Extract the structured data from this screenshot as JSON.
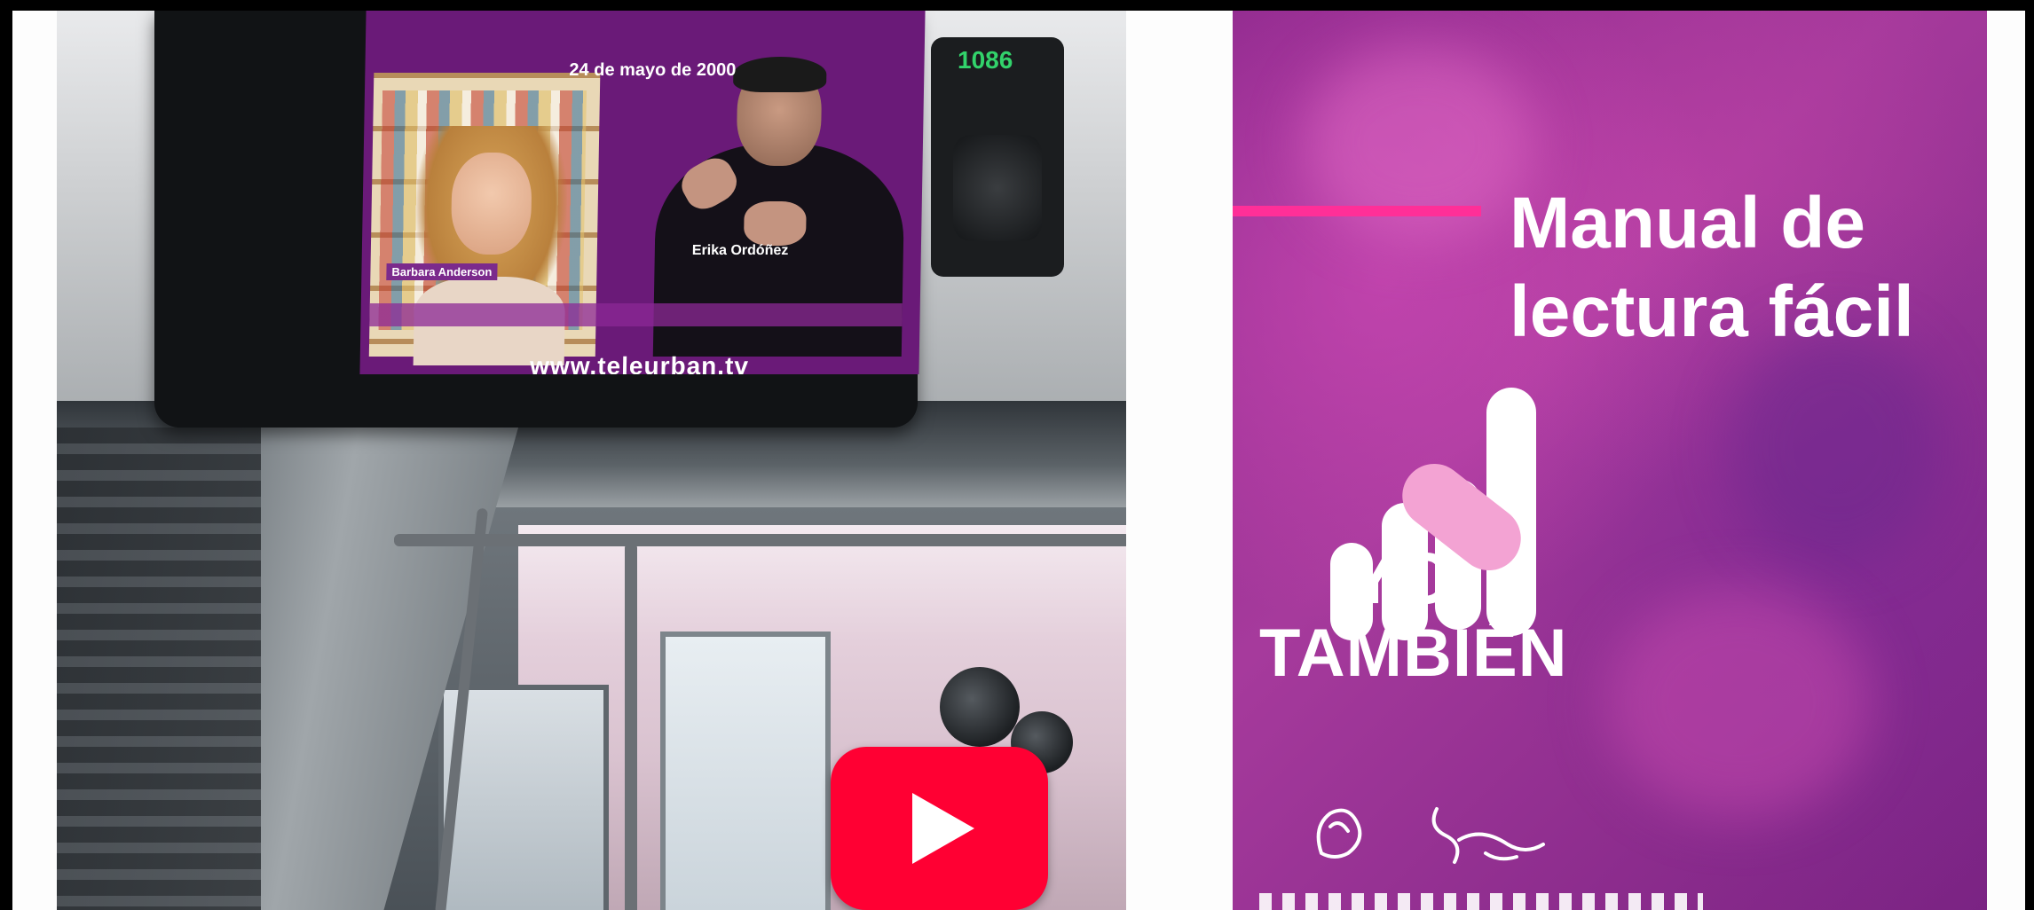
{
  "left_photo": {
    "screen_date": "24 de mayo de 2000",
    "screen_left_name": "Barbara Anderson",
    "screen_right_name": "Erika Ordóñez",
    "screen_url": "www.teleurban.tv",
    "device_counter": "1086",
    "play_button_icon": "youtube-play-icon"
  },
  "poster": {
    "title_line1": "Manual de",
    "title_line2": "lectura fácil",
    "logo_yo": "YO",
    "logo_tambien": "TAMBIÉN",
    "accent_color": "#ff2f98",
    "background_color": "#8f2a8e"
  }
}
